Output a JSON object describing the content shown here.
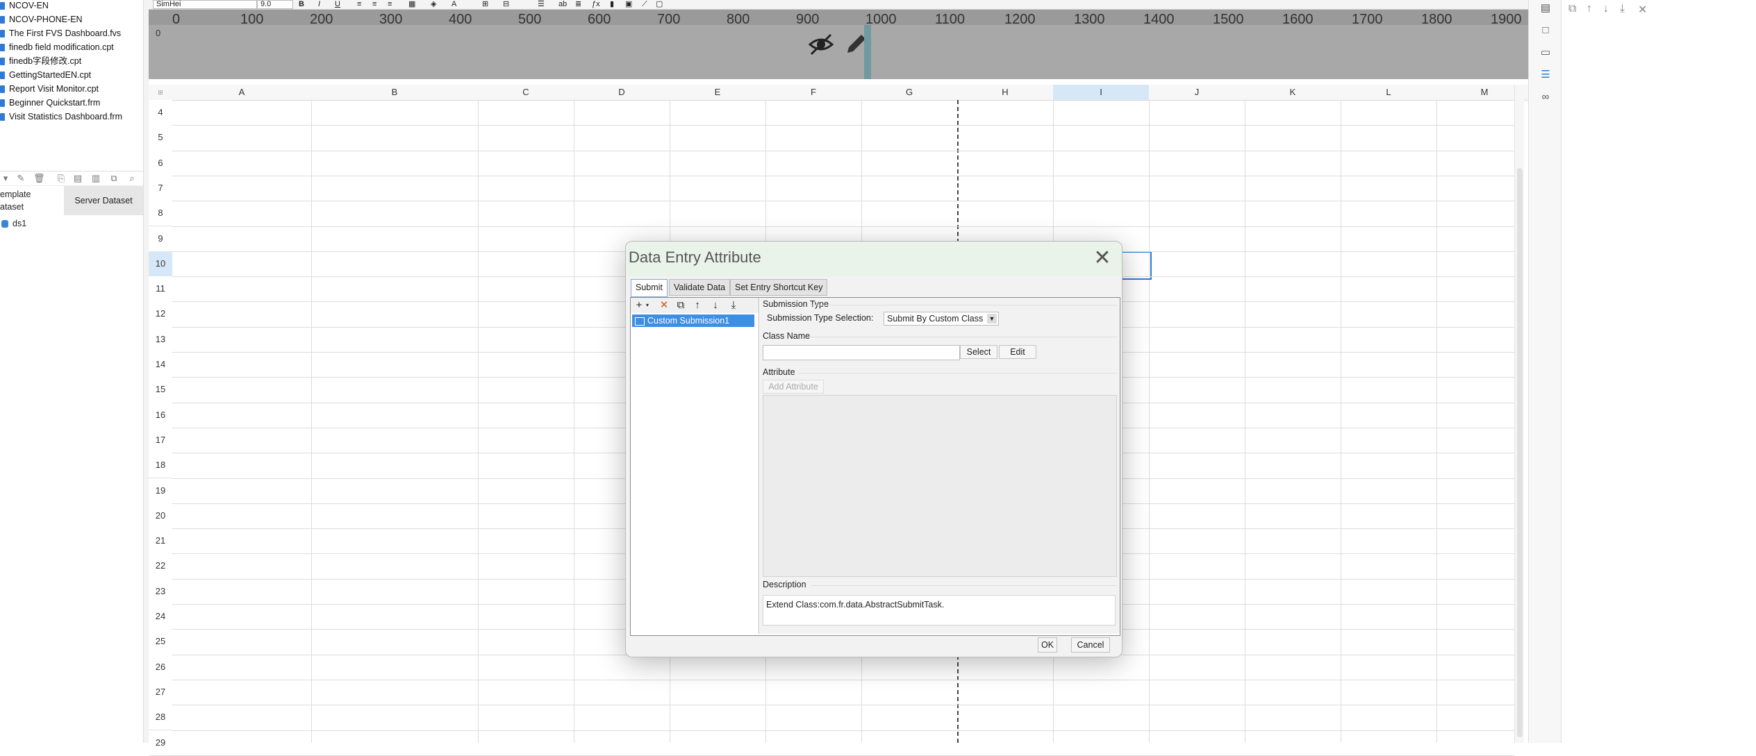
{
  "file_tree": {
    "items": [
      "NCOV-EN",
      "NCOV-PHONE-EN",
      "The First FVS Dashboard.fvs",
      "finedb field modification.cpt",
      "finedb字段修改.cpt",
      "GettingStartedEN.cpt",
      "Report Visit Monitor.cpt",
      "Beginner Quickstart.frm",
      "Visit Statistics Dashboard.frm"
    ]
  },
  "dataset_panel": {
    "tab_template_line1": "emplate",
    "tab_template_line2": "ataset",
    "tab_server": "Server Dataset",
    "dataset_item": "ds1"
  },
  "toolbar": {
    "font_name": "SimHei",
    "font_size": "9.0",
    "bold": "B",
    "italic": "I",
    "underline": "U"
  },
  "ruler": {
    "ticks": [
      "0",
      "100",
      "200",
      "300",
      "400",
      "500",
      "600",
      "700",
      "800",
      "900",
      "1000",
      "1100",
      "1200",
      "1300",
      "1400",
      "1500",
      "1600",
      "1700",
      "1800",
      "1900"
    ],
    "vertical_zero": "0"
  },
  "grid": {
    "columns": [
      "A",
      "B",
      "C",
      "D",
      "E",
      "F",
      "G",
      "H",
      "I",
      "J",
      "K",
      "L",
      "M"
    ],
    "rows": [
      "4",
      "5",
      "6",
      "7",
      "8",
      "9",
      "10",
      "11",
      "12",
      "13",
      "14",
      "15",
      "16",
      "17",
      "18",
      "19",
      "20",
      "21",
      "22",
      "23",
      "24",
      "25",
      "26",
      "27",
      "28",
      "29"
    ],
    "active_column": "I",
    "active_row": "10"
  },
  "dialog": {
    "title": "Data Entry Attribute",
    "close_glyph": "✕",
    "tabs": [
      "Submit",
      "Validate Data",
      "Set Entry Shortcut Key"
    ],
    "tree_item": "Custom Submission1",
    "submission_type_label": "Submission Type",
    "submission_type_selection_label": "Submission Type Selection:",
    "submission_type_value": "Submit By Custom Class",
    "class_name_label": "Class Name",
    "select_button": "Select",
    "edit_button": "Edit",
    "attribute_label": "Attribute",
    "add_attribute_button": "Add Attribute",
    "description_label": "Description",
    "description_text": "Extend Class:com.fr.data.AbstractSubmitTask.",
    "ok_button": "OK",
    "cancel_button": "Cancel"
  },
  "colors": {
    "selection_blue": "#3d8fe5",
    "ruler_gray": "#a8a8a8",
    "dialog_title_bg": "#eaf3ea"
  }
}
